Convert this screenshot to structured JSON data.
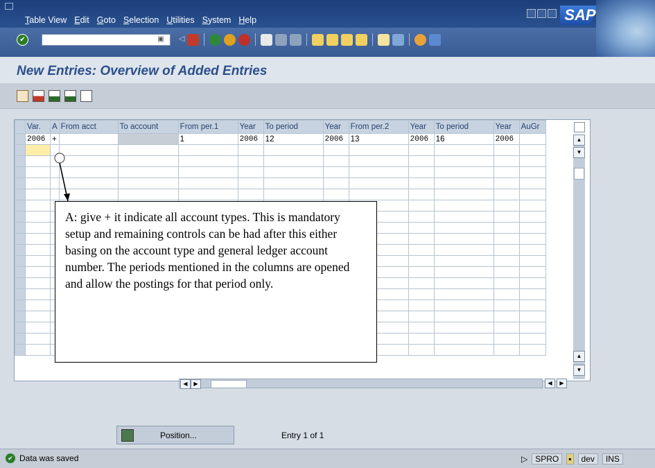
{
  "menu": [
    "Table View",
    "Edit",
    "Goto",
    "Selection",
    "Utilities",
    "System",
    "Help"
  ],
  "brand": "SAP",
  "page_title": "New Entries: Overview of Added Entries",
  "table": {
    "columns": [
      "Var.",
      "A",
      "From acct",
      "To account",
      "From per.1",
      "Year",
      "To period",
      "Year",
      "From per.2",
      "Year",
      "To period",
      "Year",
      "AuGr"
    ],
    "rows": [
      [
        "2006",
        "+",
        "",
        "",
        "1",
        "2006",
        "12",
        "2006",
        "13",
        "2006",
        "16",
        "2006",
        ""
      ]
    ],
    "empty_rows": 19
  },
  "callout_text": "A: give + it indicate all account types. This is mandatory setup and remaining controls can be had after this either basing on the account type and general ledger account number. The periods mentioned in the columns are opened and allow the postings for that period only.",
  "position_button": "Position...",
  "entry_info": "Entry 1 of 1",
  "status": {
    "message": "Data was saved",
    "transaction": "SPRO",
    "system": "dev",
    "mode": "INS"
  },
  "colors": {
    "title": "#2b4f8c",
    "menubar": "#1c3f7a",
    "focus": "#ffeea8"
  }
}
